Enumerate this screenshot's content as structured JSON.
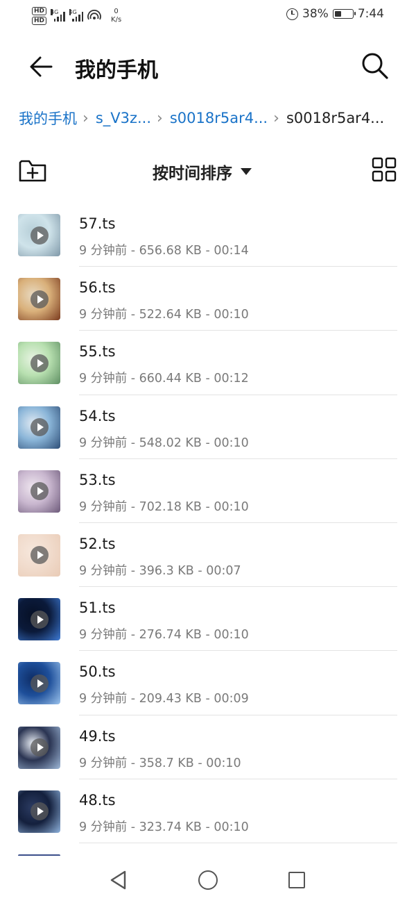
{
  "status_bar": {
    "hd1": "HD",
    "hd2": "HD",
    "sig1_label": "4G",
    "sig2_label": "4G",
    "net_speed": "0",
    "net_unit": "K/s",
    "battery_text": "38%",
    "battery_level": 0.38,
    "time": "7:44"
  },
  "header": {
    "title": "我的手机"
  },
  "breadcrumb": [
    {
      "label": "我的手机"
    },
    {
      "label": "s_V3z..."
    },
    {
      "label": "s0018r5ar4..."
    },
    {
      "label": "s0018r5ar4..."
    }
  ],
  "toolbar": {
    "sort_label": "按时间排序"
  },
  "files": [
    {
      "name": "57.ts",
      "meta": "9 分钟前 - 656.68 KB - 00:14",
      "thumb_colors": [
        "#cfe3ea",
        "#7f98a8",
        "#b7cfd8"
      ]
    },
    {
      "name": "56.ts",
      "meta": "9 分钟前 - 522.64 KB - 00:10",
      "thumb_colors": [
        "#d9b07a",
        "#7a3a1e",
        "#e8d9c0"
      ]
    },
    {
      "name": "55.ts",
      "meta": "9 分钟前 - 660.44 KB - 00:12",
      "thumb_colors": [
        "#b8e0b0",
        "#5f8f63",
        "#e7f3e2"
      ]
    },
    {
      "name": "54.ts",
      "meta": "9 分钟前 - 548.02 KB - 00:10",
      "thumb_colors": [
        "#8ab5d8",
        "#2f4f78",
        "#dfe9f2"
      ]
    },
    {
      "name": "53.ts",
      "meta": "9 分钟前 - 702.18 KB - 00:10",
      "thumb_colors": [
        "#c9b7cf",
        "#6d5a7a",
        "#efe6ef"
      ]
    },
    {
      "name": "52.ts",
      "meta": "9 分钟前 - 396.3 KB - 00:07",
      "thumb_colors": [
        "#f1dccd",
        "#e9cbb6",
        "#f6e7dc"
      ]
    },
    {
      "name": "51.ts",
      "meta": "9 分钟前 - 276.74 KB - 00:10",
      "thumb_colors": [
        "#0b1a3a",
        "#3e7bd6",
        "#061026"
      ]
    },
    {
      "name": "50.ts",
      "meta": "9 分钟前 - 209.43 KB - 00:09",
      "thumb_colors": [
        "#1e4f9a",
        "#9cc4ee",
        "#0e2d66"
      ]
    },
    {
      "name": "49.ts",
      "meta": "9 分钟前 - 358.7 KB - 00:10",
      "thumb_colors": [
        "#2a3452",
        "#9fb9d9",
        "#e9eef5"
      ]
    },
    {
      "name": "48.ts",
      "meta": "9 分钟前 - 323.74 KB - 00:10",
      "thumb_colors": [
        "#14203d",
        "#8fb3de",
        "#2c3c63"
      ]
    }
  ],
  "colors": {
    "breadcrumb_link": "#1a73c8",
    "meta_text": "#7a7a7a"
  },
  "icons": {
    "back": "arrow-left-icon",
    "search": "search-icon",
    "new_folder": "folder-plus-icon",
    "grid_view": "grid-view-icon",
    "sort_caret": "caret-down-icon"
  }
}
